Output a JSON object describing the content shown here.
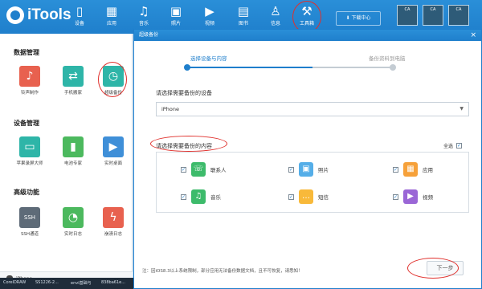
{
  "header": {
    "app_name": "iTools",
    "nav": [
      {
        "label": "设备",
        "icon": "phone-icon"
      },
      {
        "label": "应用",
        "icon": "apps-icon"
      },
      {
        "label": "音乐",
        "icon": "music-icon"
      },
      {
        "label": "照片",
        "icon": "photo-icon"
      },
      {
        "label": "视频",
        "icon": "video-icon"
      },
      {
        "label": "图书",
        "icon": "book-icon"
      },
      {
        "label": "信息",
        "icon": "user-icon"
      },
      {
        "label": "工具箱",
        "icon": "wrench-icon"
      }
    ],
    "download_center": "下载中心",
    "ca_tabs": [
      "CA",
      "CA",
      "CA"
    ]
  },
  "sidebar": {
    "sections": [
      {
        "title": "数据管理",
        "items": [
          {
            "label": "铃声制作",
            "icon": "bell-icon",
            "color": "#e8614f"
          },
          {
            "label": "手机搬家",
            "icon": "transfer-icon",
            "color": "#2eb5a8"
          },
          {
            "label": "超级备份",
            "icon": "clock-icon",
            "color": "#2eb5a8"
          }
        ]
      },
      {
        "title": "设备管理",
        "items": [
          {
            "label": "苹果录屏大师",
            "icon": "screen-icon",
            "color": "#2eb5a8"
          },
          {
            "label": "电池专家",
            "icon": "battery-icon",
            "color": "#4cb95e"
          },
          {
            "label": "实时桌面",
            "icon": "play-icon",
            "color": "#3f8fd8"
          }
        ]
      },
      {
        "title": "高级功能",
        "items": [
          {
            "label": "SSH通道",
            "icon": "ssh-icon",
            "color": "#5e6b78"
          },
          {
            "label": "实时日志",
            "icon": "log-icon",
            "color": "#4cb95e"
          },
          {
            "label": "崩溃日志",
            "icon": "crash-icon",
            "color": "#e8614f"
          }
        ]
      }
    ]
  },
  "device_bar": {
    "name": "iPhone"
  },
  "taskbar": {
    "items": [
      "CorelDRAW",
      "SS1226-2...",
      "envi基础与",
      "838ba61e..."
    ]
  },
  "dialog": {
    "title": "超级备份",
    "close": "×",
    "steps": [
      {
        "label": "选择设备与内容",
        "active": true
      },
      {
        "label": "备份资料到电脑",
        "active": false
      }
    ],
    "device_label": "请选择需要备份的设备",
    "device_value": "iPhone",
    "content_label": "请选择需要备份的内容",
    "select_all": "全选",
    "items": [
      {
        "label": "联系人",
        "icon": "contacts-icon",
        "checked": true,
        "color": "#3dbb6b"
      },
      {
        "label": "照片",
        "icon": "photo-icon",
        "checked": true,
        "color": "#55aee8"
      },
      {
        "label": "应用",
        "icon": "apps-icon",
        "checked": true,
        "color": "#f6a13a"
      },
      {
        "label": "音乐",
        "icon": "music-icon",
        "checked": true,
        "color": "#3dbb6b"
      },
      {
        "label": "短信",
        "icon": "chat-icon",
        "checked": true,
        "color": "#f8b93a"
      },
      {
        "label": "视频",
        "icon": "video-icon",
        "checked": true,
        "color": "#9a66d6"
      }
    ],
    "note": "注：因iOS8.3以上系统限制，部分应用无法备份数据文档，且不可恢复，请悉知！",
    "next_button": "下一步"
  },
  "colors": {
    "header_blue": "#1f7fcc",
    "annotation_red": "#e0302c",
    "step_active": "#1f7fcc",
    "step_inactive": "#c4ccd3"
  }
}
